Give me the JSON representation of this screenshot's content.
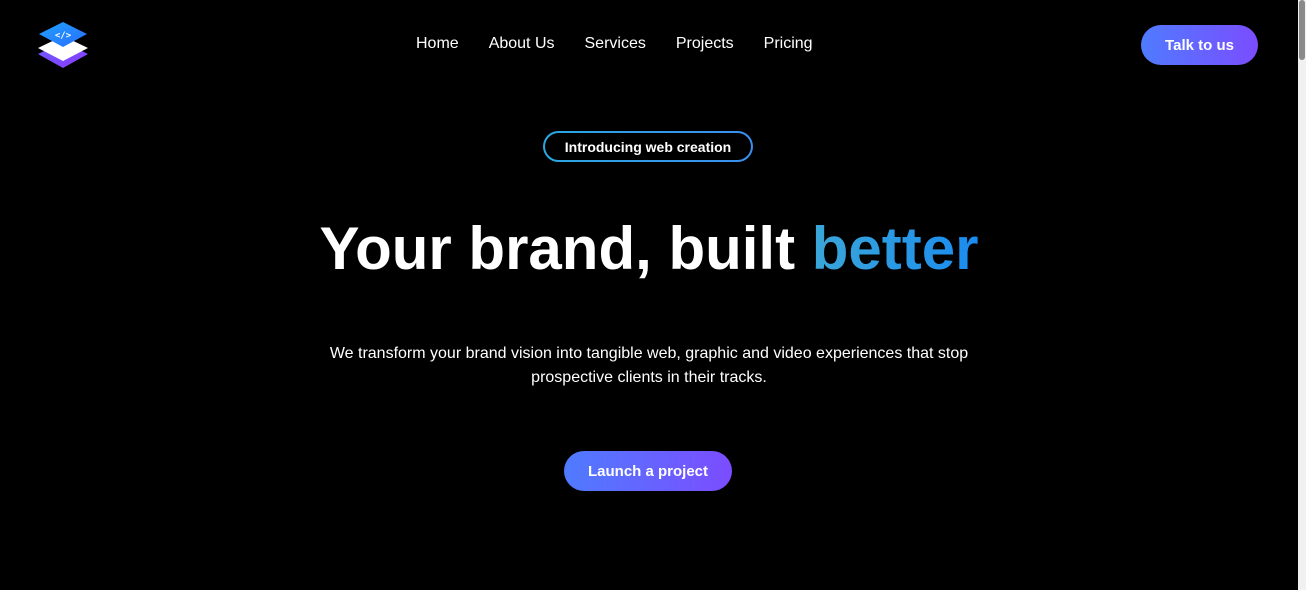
{
  "colors": {
    "background": "#000000",
    "accent_gradient_start": "#4f7bff",
    "accent_gradient_end": "#7b4dff",
    "headline_accent": "#1a8cf0",
    "badge_border": "#2aa7e0"
  },
  "logo": {
    "icon": "code-layers-logo-icon"
  },
  "nav": {
    "items": [
      {
        "label": "Home"
      },
      {
        "label": "About Us"
      },
      {
        "label": "Services"
      },
      {
        "label": "Projects"
      },
      {
        "label": "Pricing"
      }
    ]
  },
  "header": {
    "cta_label": "Talk to us"
  },
  "hero": {
    "badge": "Introducing web creation",
    "headline_main": "Your brand, built ",
    "headline_accent": "better",
    "subtitle_line1": "We transform your brand vision into tangible web, graphic and video experiences that stop",
    "subtitle_line2": "prospective clients in their tracks.",
    "cta_label": "Launch a project"
  }
}
